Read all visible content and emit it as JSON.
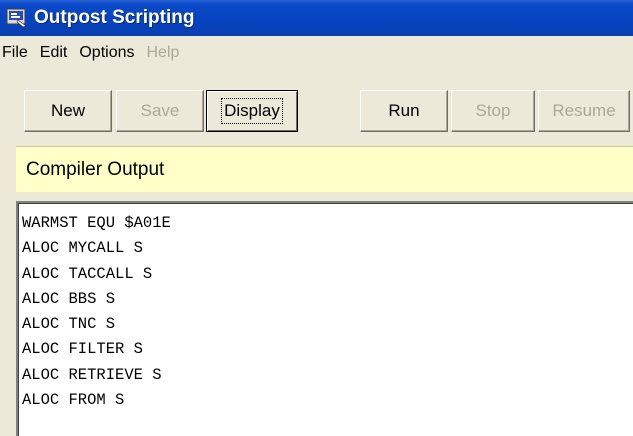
{
  "window": {
    "title": "Outpost Scripting",
    "icon": "app-icon"
  },
  "menu": {
    "items": [
      {
        "label": "File",
        "enabled": true
      },
      {
        "label": "Edit",
        "enabled": true
      },
      {
        "label": "Options",
        "enabled": true
      },
      {
        "label": "Help",
        "enabled": false
      }
    ]
  },
  "toolbar": {
    "buttons": [
      {
        "label": "New",
        "enabled": true
      },
      {
        "label": "Save",
        "enabled": false
      },
      {
        "label": "Display",
        "enabled": true,
        "focused": true
      },
      {
        "label": "Run",
        "enabled": true
      },
      {
        "label": "Stop",
        "enabled": false
      },
      {
        "label": "Resume",
        "enabled": false
      }
    ]
  },
  "panel": {
    "header": "Compiler Output"
  },
  "output": {
    "lines": [
      "WARMST EQU $A01E",
      "ALOC MYCALL S",
      "ALOC TACCALL S",
      "ALOC BBS S",
      "ALOC TNC S",
      "ALOC FILTER S",
      "ALOC RETRIEVE S",
      "ALOC FROM S"
    ]
  },
  "colors": {
    "titlebar": "#0543c0",
    "face": "#ece9d8",
    "header_bg": "#ffffc8",
    "disabled_text": "#aca899"
  }
}
